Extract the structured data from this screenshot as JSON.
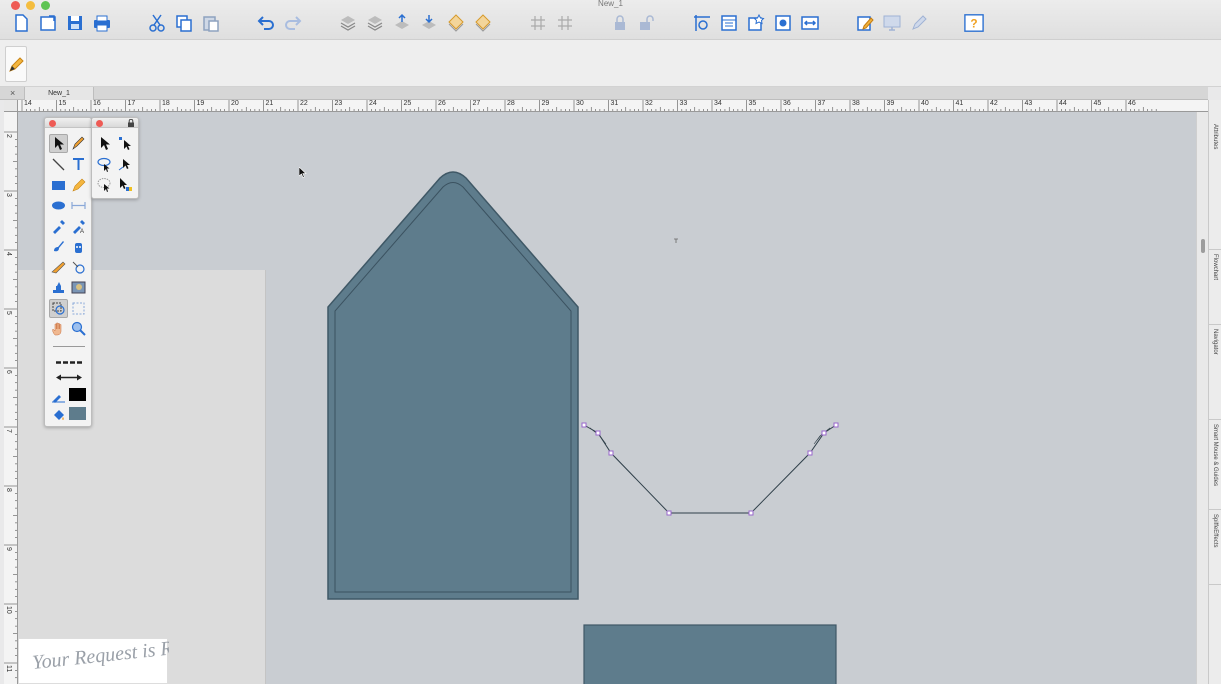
{
  "window": {
    "title": "New_1"
  },
  "document_tab": {
    "label": "New_1",
    "close_symbol": "×"
  },
  "toolbar": {
    "icons": [
      "new-document-icon",
      "open-document-icon",
      "save-icon",
      "print-icon",
      "cut-icon",
      "copy-icon",
      "paste-icon",
      "undo-icon",
      "redo-icon",
      "layer-send-back-icon",
      "layer-back-icon",
      "layer-forward-icon",
      "layer-bring-front-icon",
      "layer-arrange-icon",
      "layer-arrange-2-icon",
      "grid-icon",
      "grid-snap-icon",
      "lock-icon",
      "unlock-icon",
      "view-options-icon",
      "window-icon",
      "shapes-library-icon",
      "record-icon",
      "fit-width-icon",
      "edit-icon",
      "display-icon",
      "pen-settings-icon",
      "help-icon"
    ]
  },
  "ruler": {
    "horizontal_labels": [
      "14",
      "15",
      "16",
      "17",
      "18",
      "19",
      "20",
      "21",
      "22",
      "23",
      "24",
      "25",
      "26",
      "27",
      "28",
      "29",
      "30",
      "31",
      "32",
      "33",
      "34",
      "35",
      "36",
      "37",
      "38",
      "39",
      "40",
      "41",
      "42",
      "43",
      "44",
      "45",
      "46"
    ],
    "vertical_labels": [
      "2",
      "3",
      "4",
      "5",
      "6",
      "7",
      "8",
      "9",
      "10",
      "11"
    ]
  },
  "side_tabs": [
    "Attributes",
    "Flowchart",
    "Navigator",
    "Smart Mouse & Guides",
    "SpiffeEffects"
  ],
  "canvas": {
    "shape_fill": "#5e7c8c",
    "shape_stroke": "#3f5866",
    "background": "#c9cdd2",
    "selection_color": "#9966cc"
  },
  "palettes": {
    "main_tools": [
      "select-arrow-icon",
      "pen-icon",
      "line-icon",
      "text-icon",
      "rectangle-icon",
      "pencil-icon",
      "ellipse-icon",
      "dimension-icon",
      "eyedropper-icon",
      "eyedropper-text-icon",
      "brush-icon",
      "spray-icon",
      "knife-icon",
      "rotate-icon",
      "stamp-icon",
      "image-icon",
      "magic-wand-icon",
      "lasso-icon",
      "hand-icon",
      "zoom-icon",
      "line-style-icon",
      "arrowhead-style-icon",
      "stroke-color-icon",
      "fill-color-icon"
    ],
    "select_tools": [
      "arrow-select-icon",
      "node-select-icon",
      "lasso-select-icon",
      "direct-node-icon",
      "shape-select-icon",
      "color-select-icon"
    ]
  },
  "watermark": {
    "text": "Your Request is Regretted"
  }
}
